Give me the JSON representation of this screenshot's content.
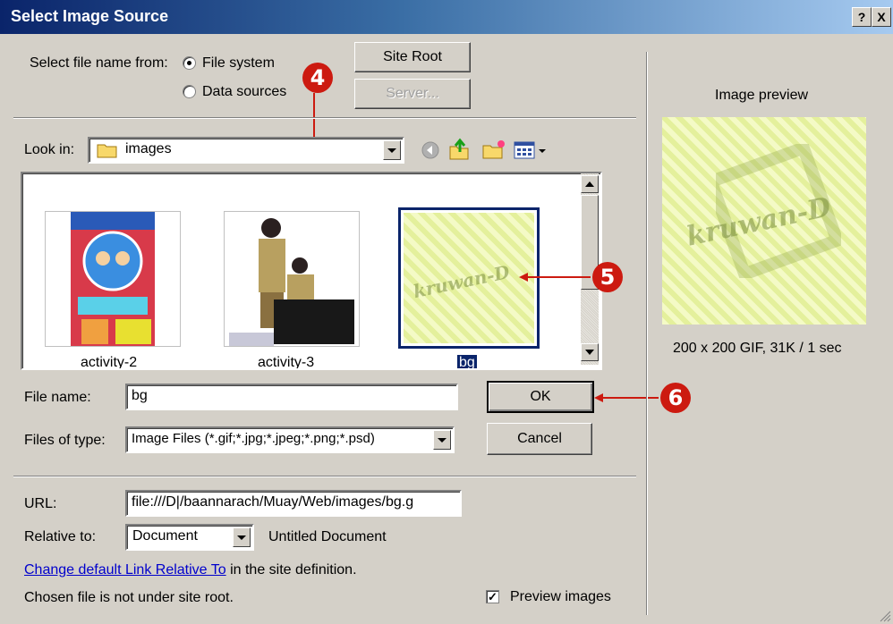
{
  "window": {
    "title": "Select Image Source",
    "help_btn": "?",
    "close_btn": "X"
  },
  "source": {
    "label": "Select file name from:",
    "options": [
      {
        "label": "File system",
        "selected": true
      },
      {
        "label": "Data sources",
        "selected": false
      }
    ]
  },
  "buttons": {
    "site_root": "Site Root",
    "server": "Server...",
    "ok": "OK",
    "cancel": "Cancel"
  },
  "look_in": {
    "label": "Look in:",
    "value": "images"
  },
  "files": [
    {
      "name": "activity-2",
      "selected": false
    },
    {
      "name": "activity-3",
      "selected": false
    },
    {
      "name": "bg",
      "selected": true
    }
  ],
  "thumb_overlay_text": "kruwan-D",
  "file_name": {
    "label": "File name:",
    "value": "bg"
  },
  "file_type": {
    "label": "Files of type:",
    "value": "Image Files (*.gif;*.jpg;*.jpeg;*.png;*.psd)"
  },
  "url": {
    "label": "URL:",
    "value": "file:///D|/baannarach/Muay/Web/images/bg.g"
  },
  "relative": {
    "label": "Relative to:",
    "value": "Document",
    "note": "Untitled Document"
  },
  "link": {
    "text": "Change default Link Relative To",
    "suffix": " in the site definition."
  },
  "status": "Chosen file is not under site root.",
  "preview": {
    "heading": "Image preview",
    "info": "200 x 200 GIF, 31K / 1 sec",
    "checkbox_label": "Preview images",
    "checked": true
  },
  "markers": [
    "4",
    "5",
    "6"
  ],
  "colors": {
    "marker": "#cc1a10",
    "title_bar": "#0a246a",
    "selection": "#0a246a"
  }
}
